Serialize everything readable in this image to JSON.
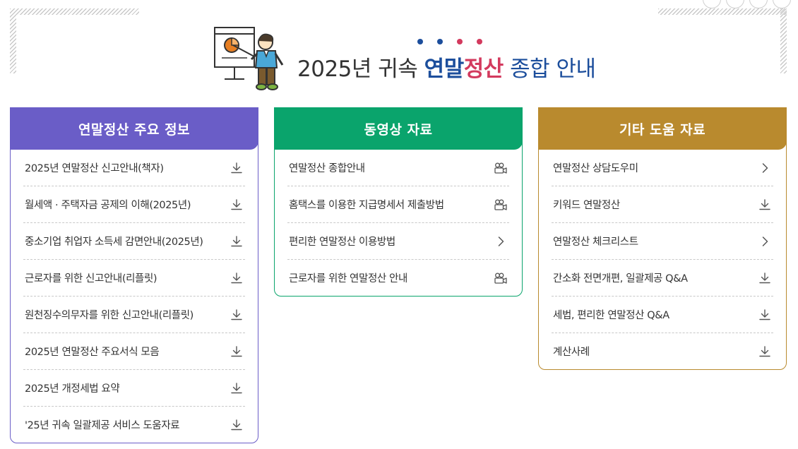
{
  "header": {
    "title_prefix": "2025년 귀속 ",
    "title_highlight_blue": "연말",
    "title_highlight_red": "정산",
    "title_suffix": " 종합 안내",
    "dot_colors": [
      "#1c4e9c",
      "#1c4e9c",
      "#d33a5e",
      "#d33a5e"
    ]
  },
  "colors": {
    "purple": "#6a5dc7",
    "green": "#0aa46c",
    "gold": "#b98a2e",
    "title_blue": "#1c4e9c",
    "title_red": "#d33a5e"
  },
  "panels": [
    {
      "title": "연말정산 주요 정보",
      "items": [
        {
          "label": "2025년 연말정산 신고안내(책자)",
          "icon": "download-icon"
        },
        {
          "label": "월세액 · 주택자금 공제의 이해(2025년)",
          "icon": "download-icon"
        },
        {
          "label": "중소기업 취업자 소득세 감면안내(2025년)",
          "icon": "download-icon"
        },
        {
          "label": "근로자를 위한 신고안내(리플릿)",
          "icon": "download-icon"
        },
        {
          "label": "원천징수의무자를 위한 신고안내(리플릿)",
          "icon": "download-icon"
        },
        {
          "label": "2025년 연말정산 주요서식 모음",
          "icon": "download-icon"
        },
        {
          "label": "2025년 개정세법 요약",
          "icon": "download-icon"
        },
        {
          "label": "'25년 귀속 일괄제공 서비스 도움자료",
          "icon": "download-icon"
        }
      ]
    },
    {
      "title": "동영상 자료",
      "items": [
        {
          "label": "연말정산 종합안내",
          "icon": "video-camera-icon"
        },
        {
          "label": "홈택스를 이용한 지급명세서 제출방법",
          "icon": "video-camera-icon"
        },
        {
          "label": "편리한 연말정산 이용방법",
          "icon": "chevron-right-icon"
        },
        {
          "label": "근로자를 위한 연말정산 안내",
          "icon": "video-camera-icon"
        }
      ]
    },
    {
      "title": "기타 도움 자료",
      "items": [
        {
          "label": "연말정산 상담도우미",
          "icon": "chevron-right-icon"
        },
        {
          "label": "키워드 연말정산",
          "icon": "download-icon"
        },
        {
          "label": "연말정산 체크리스트",
          "icon": "chevron-right-icon"
        },
        {
          "label": "간소화 전면개편, 일괄제공 Q&A",
          "icon": "download-icon"
        },
        {
          "label": "세법, 편리한 연말정산 Q&A",
          "icon": "download-icon"
        },
        {
          "label": "계산사례",
          "icon": "download-icon"
        }
      ]
    }
  ]
}
